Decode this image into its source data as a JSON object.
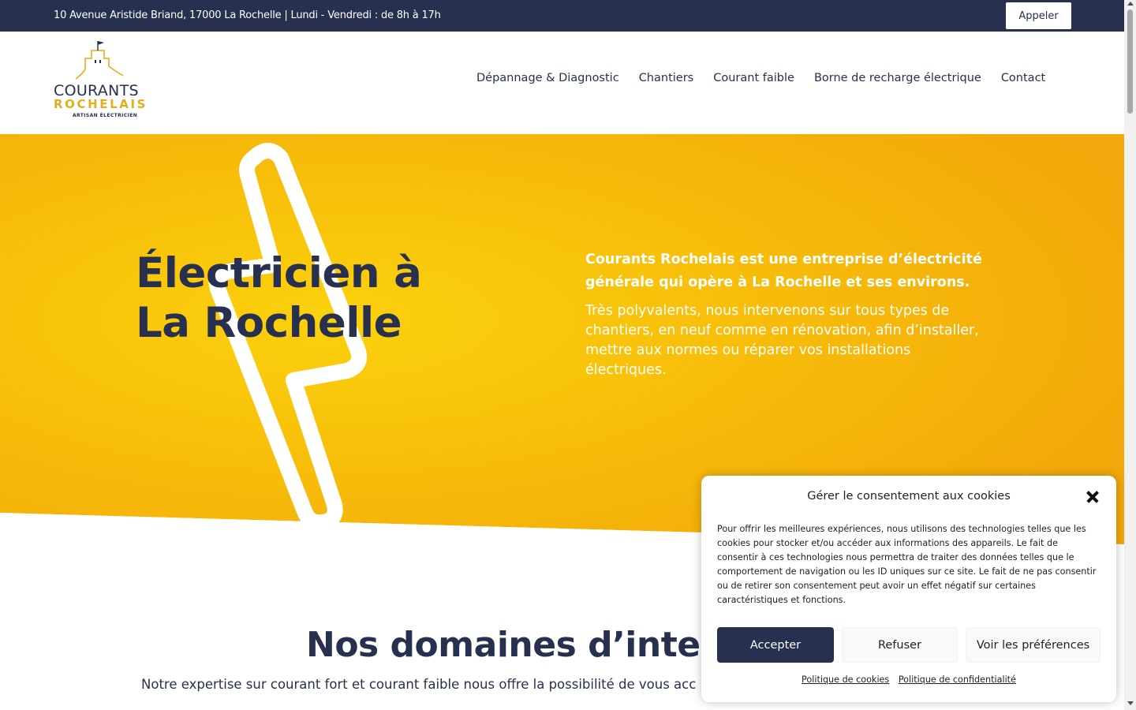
{
  "topbar": {
    "info": "10 Avenue Aristide Briand, 17000 La Rochelle | Lundi - Vendredi : de 8h à 17h",
    "call_label": "Appeler"
  },
  "logo": {
    "line1": "COURANTS",
    "line2": "ROCHELAIS",
    "line3": "ARTISAN ÉLECTRICIEN"
  },
  "nav": {
    "items": [
      {
        "label": "Dépannage & Diagnostic"
      },
      {
        "label": "Chantiers"
      },
      {
        "label": "Courant faible"
      },
      {
        "label": "Borne de recharge électrique"
      },
      {
        "label": "Contact"
      }
    ]
  },
  "hero": {
    "title_line1": "Électricien à",
    "title_line2": "La Rochelle",
    "lead": "Courants Rochelais est une entreprise d’électricité générale qui opère à La Rochelle et ses environs.",
    "description": "Très polyvalents, nous intervenons sur tous types de chantiers, en neuf comme en rénovation, afin d’installer, mettre aux normes ou réparer vos installations électriques."
  },
  "section": {
    "title": "Nos domaines d’interve",
    "subtitle": "Notre expertise sur courant fort et courant faible nous offre la possibilité de vous acc"
  },
  "cookie": {
    "title": "Gérer le consentement aux cookies",
    "text": "Pour offrir les meilleures expériences, nous utilisons des technologies telles que les cookies pour stocker et/ou accéder aux informations des appareils. Le fait de consentir à ces technologies nous permettra de traiter des données telles que le comportement de navigation ou les ID uniques sur ce site. Le fait de ne pas consentir ou de retirer son consentement peut avoir un effet négatif sur certaines caractéristiques et fonctions.",
    "accept_label": "Accepter",
    "refuse_label": "Refuser",
    "prefs_label": "Voir les préférences",
    "cookie_policy_label": "Politique de cookies",
    "privacy_policy_label": "Politique de confidentialité"
  },
  "colors": {
    "navy": "#27304f",
    "yellow": "#f6b80a",
    "gold": "#e3ad1c"
  }
}
